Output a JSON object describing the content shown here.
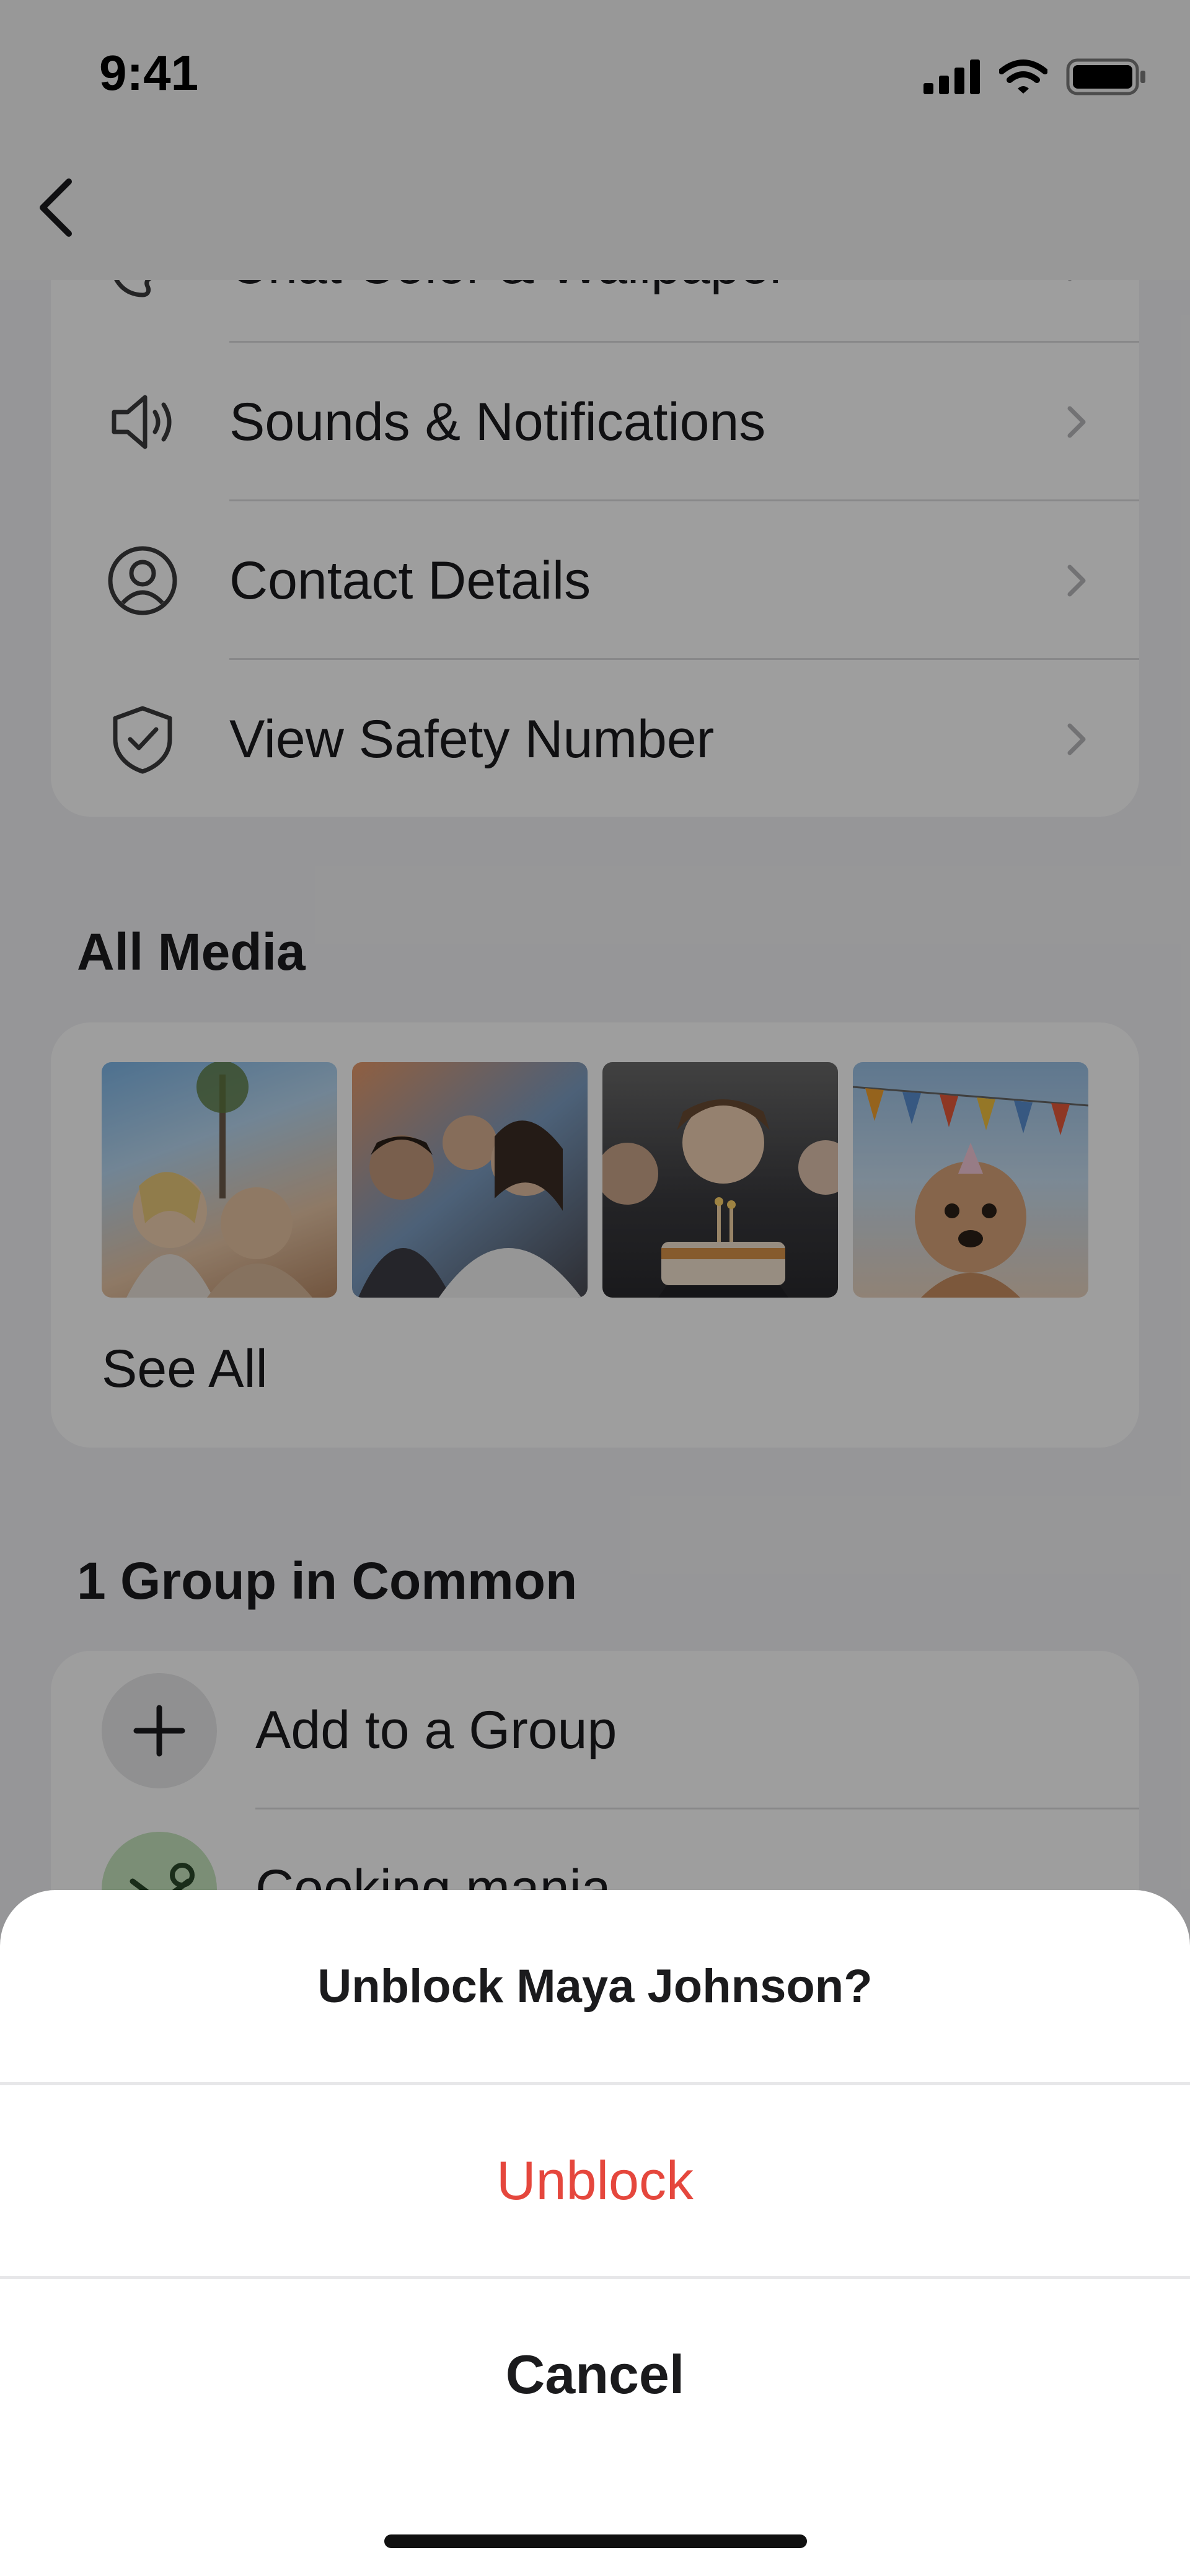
{
  "status_bar": {
    "time": "9:41"
  },
  "settings": {
    "partial_item": "Chat Color & Wallpaper",
    "items": [
      {
        "label": "Sounds & Notifications",
        "icon": "speaker-icon"
      },
      {
        "label": "Contact Details",
        "icon": "person-circle-icon"
      },
      {
        "label": "View Safety Number",
        "icon": "shield-check-icon"
      }
    ]
  },
  "media": {
    "title": "All Media",
    "see_all": "See All",
    "thumbnails": [
      "photo-friends-selfie",
      "photo-group-hug",
      "photo-birthday-cake",
      "photo-party-dog"
    ]
  },
  "groups": {
    "title": "1 Group in Common",
    "add_label": "Add to a Group",
    "items": [
      {
        "label": "Cooking mania"
      }
    ]
  },
  "action_sheet": {
    "title": "Unblock Maya Johnson?",
    "unblock_label": "Unblock",
    "cancel_label": "Cancel"
  },
  "colors": {
    "destructive": "#e5473d",
    "card": "#ffffff",
    "background": "#f3f3f5",
    "overlay": "rgba(0,0,0,0.38)"
  }
}
